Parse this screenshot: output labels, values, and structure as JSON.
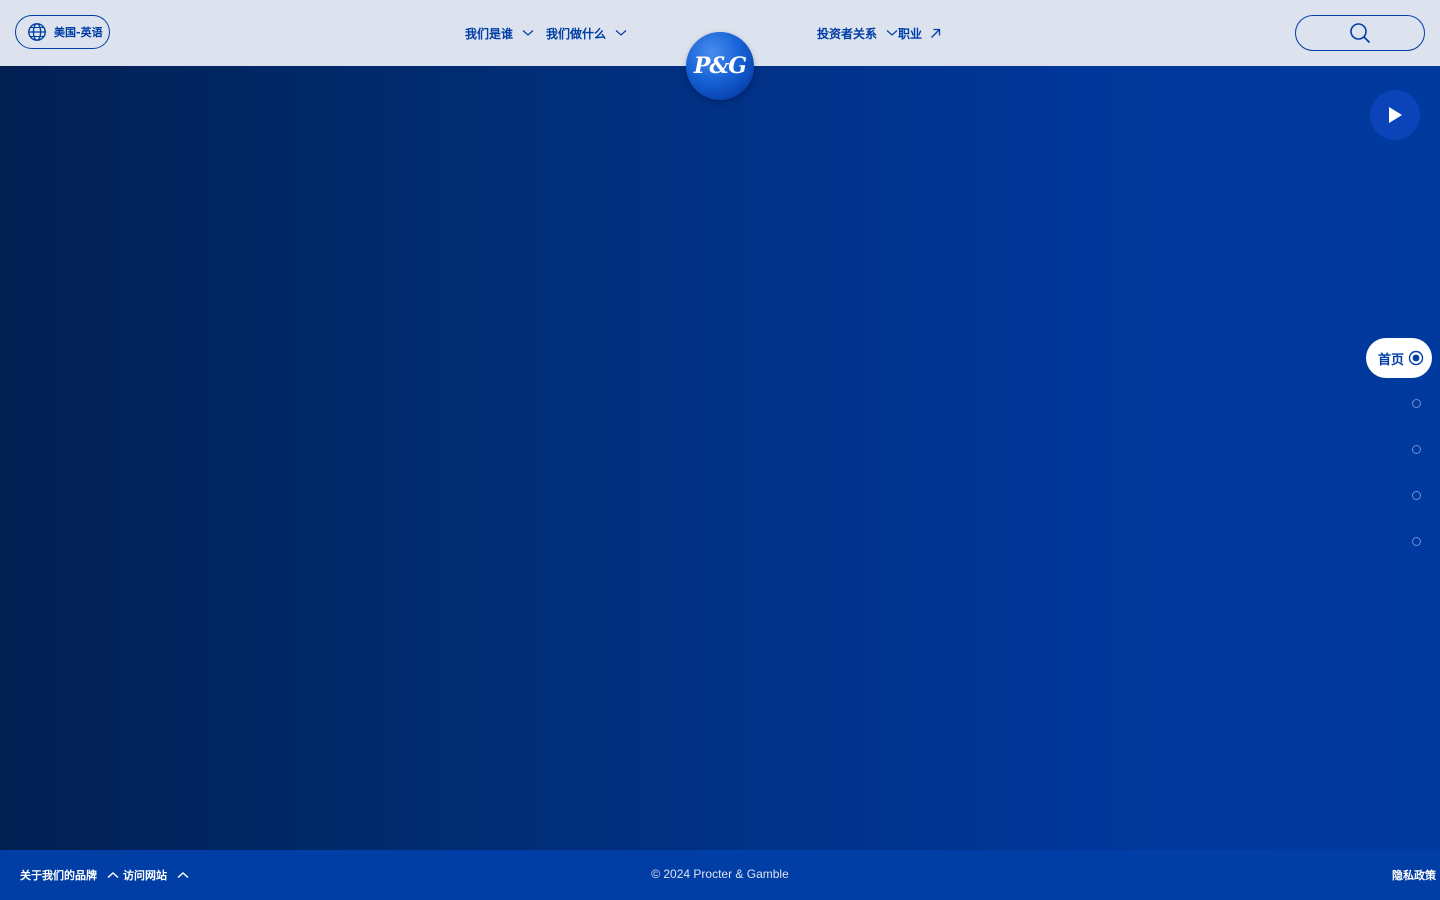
{
  "header": {
    "locale_label": "美国-英语",
    "nav": [
      {
        "label": "我们是谁"
      },
      {
        "label": "我们做什么"
      },
      {
        "label": "投资者关系"
      },
      {
        "label": "职业"
      }
    ],
    "logo_text": "P&G",
    "search_placeholder": ""
  },
  "hero": {
    "play_label": "play"
  },
  "section_nav": {
    "active_label": "首页",
    "dots": 4
  },
  "footer": {
    "links": [
      {
        "label": "关于我们的品牌"
      },
      {
        "label": "访问网站"
      }
    ],
    "copyright": "© 2024 Procter & Gamble",
    "right_label": "隐私政策"
  },
  "colors": {
    "brand_blue": "#003da5",
    "header_bg": "#dce3ef",
    "hero_dark": "#021f52",
    "hero_light": "#013a9e",
    "white": "#ffffff"
  },
  "icons": [
    "globe-icon",
    "chevron-down-icon",
    "external-arrow-icon",
    "search-icon",
    "play-icon",
    "radio-active-icon",
    "chevron-up-icon"
  ]
}
